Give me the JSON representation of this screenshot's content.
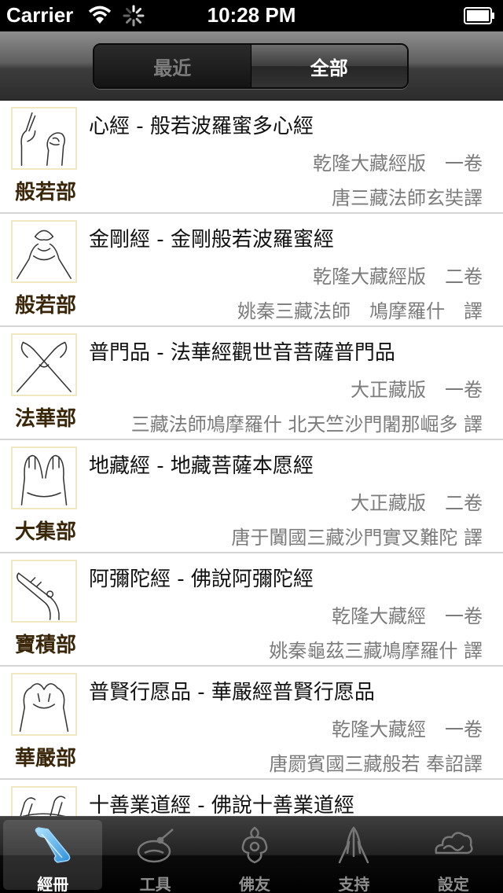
{
  "status_bar": {
    "carrier": "Carrier",
    "time": "10:28 PM"
  },
  "segmented": {
    "recent": "最近",
    "all": "全部",
    "selected": "all"
  },
  "items": [
    {
      "icon": "prajna-mudra-icon",
      "category": "般若部",
      "title": "心經 - 般若波羅蜜多心經",
      "edition": "乾隆大藏經版　一卷",
      "translator": "唐三藏法師玄奘譯"
    },
    {
      "icon": "diamond-mudra-icon",
      "category": "般若部",
      "title": "金剛經 - 金剛般若波羅蜜經",
      "edition": "乾隆大藏經版　二卷",
      "translator": "姚秦三藏法師　鳩摩羅什　譯"
    },
    {
      "icon": "lotus-mudra-icon",
      "category": "法華部",
      "title": "普門品 - 法華經觀世音菩薩普門品",
      "edition": "大正藏版　一卷",
      "translator": "三藏法師鳩摩羅什 北天竺沙門闍那崛多 譯"
    },
    {
      "icon": "dizang-mudra-icon",
      "category": "大集部",
      "title": "地藏經 - 地藏菩薩本愿經",
      "edition": "大正藏版　二卷",
      "translator": "唐于闐國三藏沙門實叉難陀 譯"
    },
    {
      "icon": "amitabha-mudra-icon",
      "category": "寶積部",
      "title": "阿彌陀經 - 佛說阿彌陀經",
      "edition": "乾隆大藏經　一卷",
      "translator": "姚秦龜茲三藏鳩摩羅什 譯"
    },
    {
      "icon": "samantabhadra-mudra-icon",
      "category": "華嚴部",
      "title": "普賢行愿品 - 華嚴經普賢行愿品",
      "edition": "乾隆大藏經　一卷",
      "translator": "唐罽賓國三藏般若 奉詔譯"
    },
    {
      "icon": "ten-good-deeds-mudra-icon",
      "category": "",
      "title": "十善業道經 - 佛說十善業道經",
      "edition": "",
      "translator": ""
    }
  ],
  "tabs": [
    {
      "label": "經冊",
      "icon": "scroll-icon",
      "selected": true
    },
    {
      "label": "工具",
      "icon": "wooden-fish-icon",
      "selected": false
    },
    {
      "label": "佛友",
      "icon": "ruyi-cloud-icon",
      "selected": false
    },
    {
      "label": "支持",
      "icon": "praying-hands-icon",
      "selected": false
    },
    {
      "label": "設定",
      "icon": "cloud-icon",
      "selected": false
    }
  ],
  "colors": {
    "category_text": "#3a2608",
    "secondary_text": "#7b7b7b",
    "thumb_border": "#efe8c0"
  }
}
